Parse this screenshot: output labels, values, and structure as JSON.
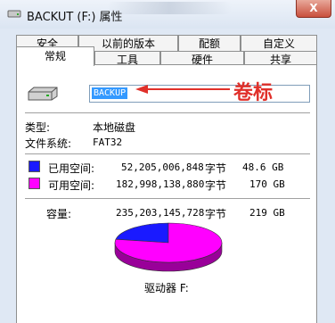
{
  "window": {
    "title": "BACKUT (F:) 属性",
    "close_label": "X"
  },
  "tabs": {
    "row_top": [
      "安全",
      "以前的版本",
      "配额",
      "自定义"
    ],
    "row_bottom": [
      "常规",
      "工具",
      "硬件",
      "共享"
    ],
    "active": "常规"
  },
  "general": {
    "volume_label": "BACKUP",
    "annotation": "卷标",
    "type_label": "类型:",
    "type_value": "本地磁盘",
    "fs_label": "文件系统:",
    "fs_value": "FAT32",
    "used_label": "已用空间:",
    "used_bytes": "52,205,006,848",
    "used_unit": "字节",
    "used_gb": "48.6 GB",
    "free_label": "可用空间:",
    "free_bytes": "182,998,138,880",
    "free_unit": "字节",
    "free_gb": "170 GB",
    "capacity_label": "容量:",
    "capacity_bytes": "235,203,145,728",
    "capacity_unit": "字节",
    "capacity_gb": "219 GB",
    "drive_label": "驱动器 F:"
  },
  "colors": {
    "used": "#1a1aff",
    "free": "#ff00ff",
    "annotation": "#e0302a"
  },
  "chart_data": {
    "type": "pie",
    "categories": [
      "已用空间",
      "可用空间"
    ],
    "values": [
      48.6,
      170
    ],
    "colors": [
      "#1a1aff",
      "#ff00ff"
    ]
  }
}
